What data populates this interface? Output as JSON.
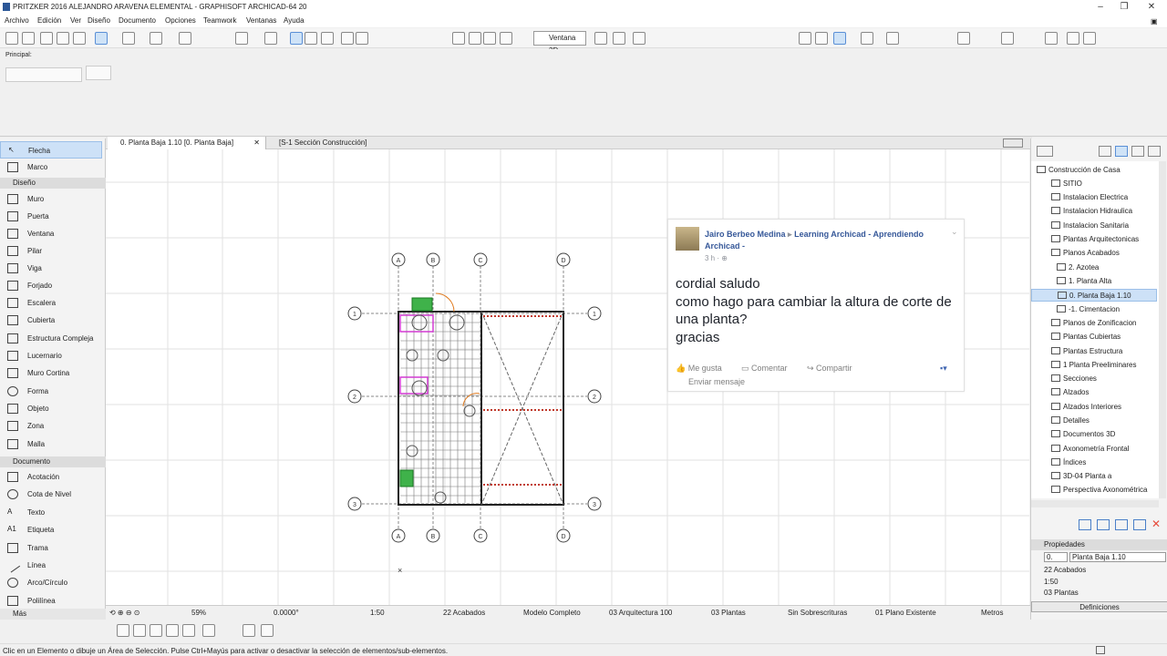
{
  "window": {
    "title": "PRITZKER 2016 ALEJANDRO ARAVENA ELEMENTAL - GRAPHISOFT ARCHICAD-64 20",
    "minimize": "–",
    "maximize": "❐",
    "close": "✕"
  },
  "menu": [
    "Archivo",
    "Edición",
    "Ver",
    "Diseño",
    "Documento",
    "Opciones",
    "Teamwork",
    "Ventanas",
    "Ayuda"
  ],
  "toolbar": {
    "ventana3d_label": "Ventana 3D"
  },
  "infobox": {
    "label": "Principal:"
  },
  "toolbox": {
    "arrow": "Flecha",
    "marquee": "Marco",
    "cat_design": "Diseño",
    "design_tools": [
      "Muro",
      "Puerta",
      "Ventana",
      "Pilar",
      "Viga",
      "Forjado",
      "Escalera",
      "Cubierta",
      "Estructura Compleja",
      "Lucernario",
      "Muro Cortina",
      "Forma",
      "Objeto",
      "Zona",
      "Malla"
    ],
    "cat_doc": "Documento",
    "doc_tools": [
      "Acotación",
      "Cota de Nivel",
      "Texto",
      "Etiqueta",
      "Trama",
      "Línea",
      "Arco/Círculo",
      "Polilínea"
    ],
    "more": "Más"
  },
  "tabs": [
    {
      "label": "0. Planta Baja 1.10 [0. Planta Baja]",
      "close": "✕"
    },
    {
      "label": "[S-1 Sección Construcción]"
    }
  ],
  "grid": {
    "cols": [
      "A",
      "B",
      "C",
      "D"
    ],
    "rows": [
      "1",
      "2",
      "3"
    ]
  },
  "post": {
    "author": "Jairo Berbeo Medina",
    "arrow": "▸",
    "group": "Learning Archicad - Aprendiendo Archicad -",
    "time": "3 h · ⊕",
    "message": [
      "cordial saludo",
      "como hago para cambiar la altura de corte de una planta?",
      "gracias"
    ],
    "like": "Me gusta",
    "comment": "Comentar",
    "share": "Compartir",
    "send": "Enviar mensaje"
  },
  "navigator": {
    "root": "Construcción de Casa",
    "items": [
      "SITIO",
      "Instalacion Electrica",
      "Instalacion Hidraulica",
      "Instalacion Sanitaria",
      "Plantas Arquitectonicas",
      "Planos Acabados",
      "2. Azotea",
      "1. Planta Alta",
      "0. Planta Baja 1.10",
      "-1. Cimentacion",
      "Planos de Zonificacion",
      "Plantas Cubiertas",
      "Plantas Estructura",
      "1 Planta Preeliminares",
      "Secciones",
      "Alzados",
      "Alzados Interiores",
      "Detalles",
      "Documentos 3D",
      "Axonometría Frontal",
      "Índices",
      "3D-04 Planta a",
      "Perspectiva Axonométrica"
    ]
  },
  "properties": {
    "header": "Propiedades",
    "id": "0.",
    "name": "Planta Baja 1.10",
    "layer": "22 Acabados",
    "scale": "1:50",
    "plants": "03 Plantas",
    "definitions": "Definiciones"
  },
  "bottombar": {
    "zoom": "59%",
    "angle": "0.0000°",
    "scale": "1:50",
    "layer": "22 Acabados",
    "model": "Modelo Completo",
    "arch": "03 Arquitectura 100",
    "plants": "03 Plantas",
    "overrides": "Sin Sobrescrituras",
    "plan": "01 Plano Existente",
    "units": "Metros"
  },
  "status": "Clic en un Elemento o dibuje un Área de Selección. Pulse Ctrl+Mayús para activar o desactivar la selección de elementos/sub-elementos."
}
